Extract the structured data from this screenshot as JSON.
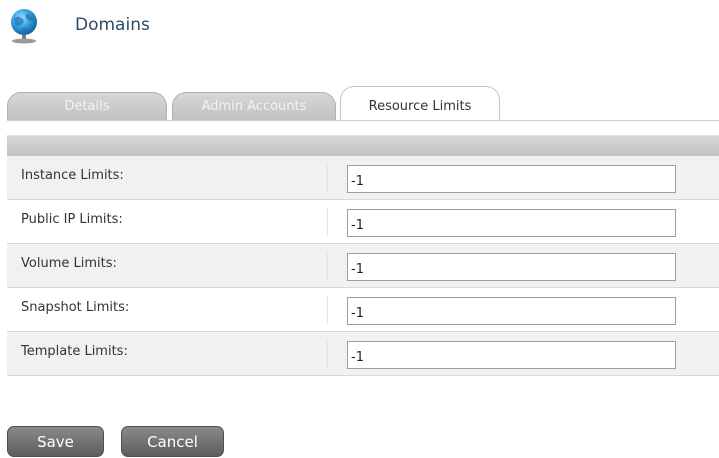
{
  "header": {
    "title": "Domains",
    "icon": "globe-icon"
  },
  "tabs": [
    {
      "label": "Details",
      "active": false
    },
    {
      "label": "Admin Accounts",
      "active": false
    },
    {
      "label": "Resource Limits",
      "active": true
    }
  ],
  "limits": [
    {
      "label": "Instance Limits:",
      "value": "-1"
    },
    {
      "label": "Public IP Limits:",
      "value": "-1"
    },
    {
      "label": "Volume Limits:",
      "value": "-1"
    },
    {
      "label": "Snapshot Limits:",
      "value": "-1"
    },
    {
      "label": "Template Limits:",
      "value": "-1"
    }
  ],
  "buttons": {
    "save_label": "Save",
    "cancel_label": "Cancel"
  },
  "colors": {
    "title": "#2d4a63",
    "button": "#6e6e6e",
    "row_alt": "#f1f1f1"
  }
}
